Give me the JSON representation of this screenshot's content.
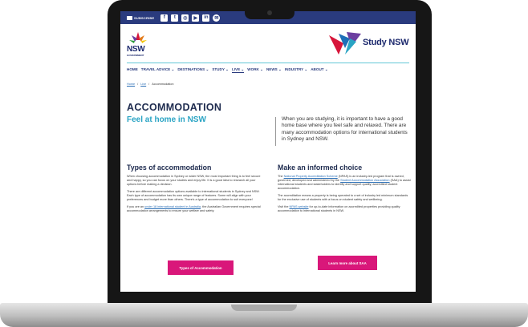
{
  "social": {
    "subscribe_label": "SUBSCRIBE",
    "icons": [
      "facebook-icon",
      "twitter-icon",
      "instagram-icon",
      "youtube-icon",
      "linkedin-icon",
      "wechat-icon"
    ],
    "glyphs": [
      "f",
      "t",
      "◎",
      "▶",
      "in",
      "✉"
    ]
  },
  "header": {
    "nsw_logo_text": "NSW",
    "nsw_logo_sub": "GOVERNMENT",
    "brand": "Study NSW"
  },
  "nav": {
    "items": [
      "HOME",
      "TRAVEL ADVICE ⌄",
      "DESTINATIONS ⌄",
      "STUDY ⌄",
      "LIVE ⌄",
      "WORK ⌄",
      "NEWS ⌄",
      "INDUSTRY ⌄",
      "ABOUT ⌄"
    ]
  },
  "breadcrumb": {
    "home": "Home",
    "sep": "/",
    "live": "Live",
    "current": "Accommodation"
  },
  "hero": {
    "title": "ACCOMMODATION",
    "subtitle": "Feel at home in NSW",
    "intro": "When you are studying, it is important to have a good home base where you feel safe and relaxed. There are many accommodation options for international students in Sydney and NSW."
  },
  "left": {
    "heading": "Types of accommodation",
    "p1": "When choosing accommodation in Sydney or wider NSW, the most important thing is to feel secure and happy, so you can focus on your studies and enjoy life. It is a good idea to research all your options before making a decision.",
    "p2": "There are different accommodation options available to international students in Sydney and NSW. Each type of accommodation has its own unique range of features. Some will align with your preferences and budget more than others. There's a type of accommodation to suit everyone!",
    "p3_pre": "If you are an ",
    "p3_link": "under 18 international student in Australia",
    "p3_post": ", the Australian Government requires special accommodation arrangements to ensure your welfare and safety.",
    "button": "Types of Accommodation"
  },
  "right": {
    "heading": "Make an informed choice",
    "p1_pre": "The ",
    "p1_link1": "National Property Accreditation Scheme",
    "p1_mid": " (NPAS) is an industry-led program that is owned, governed, developed and administered by the ",
    "p1_link2": "Student Accommodation Association",
    "p1_post": " (SAA) to assist international students and stakeholders to identify and support quality, accredited student accommodation.",
    "p2": "The accreditation means a property is being operated to a set of industry led minimum standards for the exclusive use of students with a focus on student safety and wellbeing.",
    "p3_pre": "Visit the ",
    "p3_link": "NPAS website",
    "p3_post": " for up-to-date information on accredited properties providing quality accommodation to international students in NSW.",
    "button": "Learn more about SAA"
  }
}
